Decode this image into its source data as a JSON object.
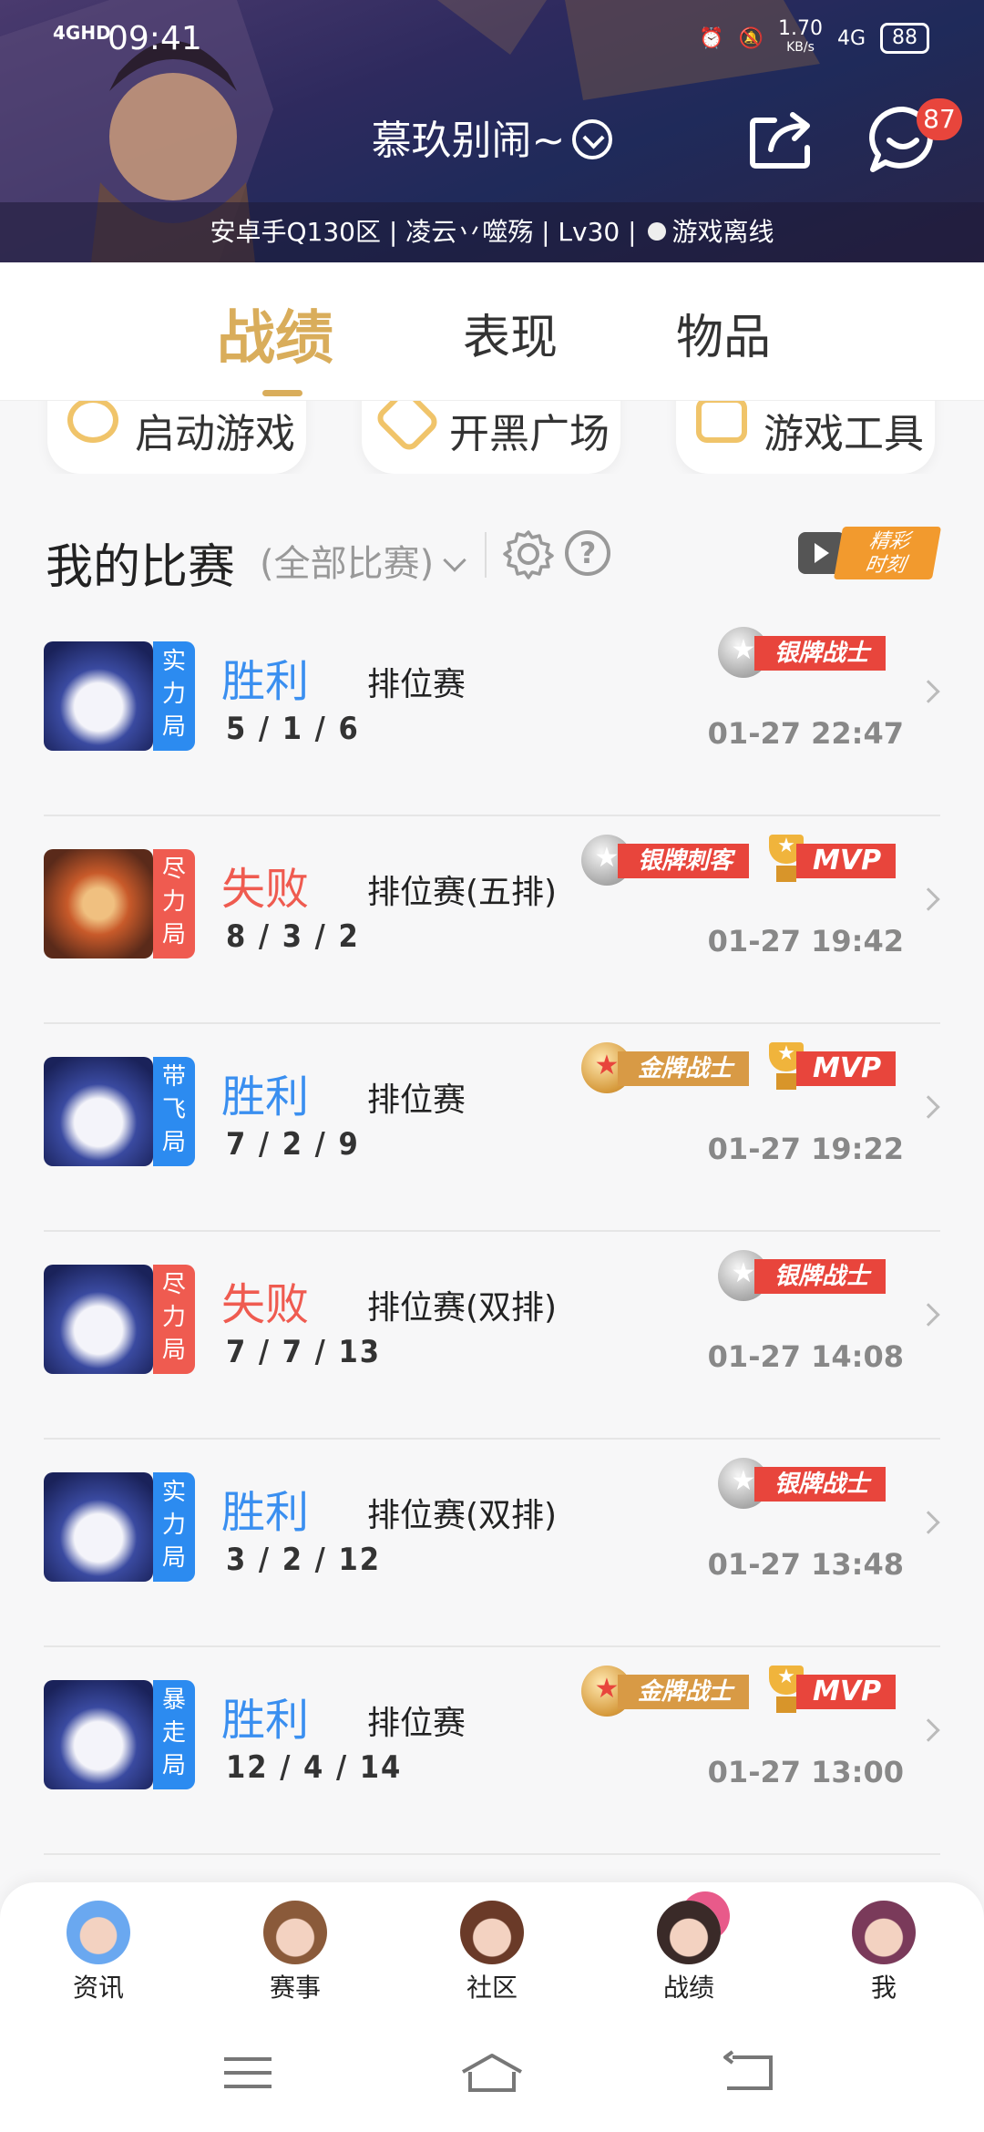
{
  "status_bar": {
    "network": "4GHD",
    "time": "09:41",
    "speed": "1.70",
    "speed_unit": "KB/s",
    "network_right": "4G",
    "battery": "88"
  },
  "header": {
    "player_name": "慕玖别闹~",
    "message_badge": "87",
    "info_line_main": "安卓手Q130区 | 凌云丷噬殇 | Lv30 |",
    "info_status": "游戏离线"
  },
  "tabs": [
    {
      "label": "战绩",
      "active": true
    },
    {
      "label": "表现",
      "active": false
    },
    {
      "label": "物品",
      "active": false
    }
  ],
  "quick_cards": [
    {
      "label": "启动游戏"
    },
    {
      "label": "开黑广场"
    },
    {
      "label": "游戏工具"
    }
  ],
  "matches_header": {
    "title": "我的比赛",
    "filter": "(全部比赛)",
    "highlight_label_line1": "精彩",
    "highlight_label_line2": "时刻"
  },
  "matches": [
    {
      "mode_tag": "实力局",
      "tag_color": "blue",
      "result": "胜利",
      "result_type": "win",
      "match_type": "排位赛",
      "kda": "5 / 1 / 6",
      "time": "01-27 22:47",
      "medal": {
        "label": "银牌战士",
        "tier": "silver"
      },
      "mvp": null
    },
    {
      "mode_tag": "尽力局",
      "tag_color": "red",
      "result": "失败",
      "result_type": "loss",
      "match_type": "排位赛(五排)",
      "kda": "8 / 3 / 2",
      "time": "01-27 19:42",
      "medal": {
        "label": "银牌刺客",
        "tier": "silver"
      },
      "mvp": "MVP"
    },
    {
      "mode_tag": "带飞局",
      "tag_color": "blue",
      "result": "胜利",
      "result_type": "win",
      "match_type": "排位赛",
      "kda": "7 / 2 / 9",
      "time": "01-27 19:22",
      "medal": {
        "label": "金牌战士",
        "tier": "gold"
      },
      "mvp": "MVP"
    },
    {
      "mode_tag": "尽力局",
      "tag_color": "red",
      "result": "失败",
      "result_type": "loss",
      "match_type": "排位赛(双排)",
      "kda": "7 / 7 / 13",
      "time": "01-27 14:08",
      "medal": {
        "label": "银牌战士",
        "tier": "silver"
      },
      "mvp": null
    },
    {
      "mode_tag": "实力局",
      "tag_color": "blue",
      "result": "胜利",
      "result_type": "win",
      "match_type": "排位赛(双排)",
      "kda": "3 / 2 / 12",
      "time": "01-27 13:48",
      "medal": {
        "label": "银牌战士",
        "tier": "silver"
      },
      "mvp": null
    },
    {
      "mode_tag": "暴走局",
      "tag_color": "blue",
      "result": "胜利",
      "result_type": "win",
      "match_type": "排位赛",
      "kda": "12 / 4 / 14",
      "time": "01-27 13:00",
      "medal": {
        "label": "金牌战士",
        "tier": "gold"
      },
      "mvp": "MVP"
    }
  ],
  "bottom_nav": [
    {
      "label": "资讯",
      "icon": "news-avatar-icon"
    },
    {
      "label": "赛事",
      "icon": "events-avatar-icon"
    },
    {
      "label": "社区",
      "icon": "community-avatar-icon"
    },
    {
      "label": "战绩",
      "icon": "record-avatar-icon"
    },
    {
      "label": "我",
      "icon": "me-avatar-icon"
    }
  ],
  "colors": {
    "accent_gold": "#d9ad5b",
    "win_blue": "#3a8ff0",
    "loss_red": "#ef5b50",
    "badge_red": "#e8453c"
  }
}
